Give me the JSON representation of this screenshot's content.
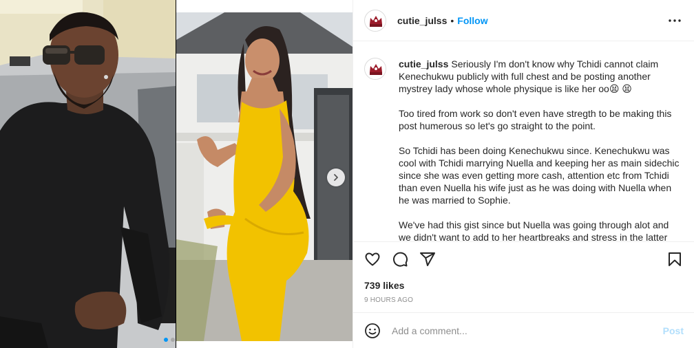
{
  "post": {
    "username": "cutie_julss",
    "separator": "•",
    "follow_label": "Follow",
    "more_icon": "more-horizontal-icon"
  },
  "caption": {
    "username": "cutie_julss",
    "paragraphs": [
      "Seriously I'm don't know why Tchidi cannot claim Kenechukwu publicly with full chest and be posting another mystrey lady whose whole physique is like her oo😫 😫",
      "Too tired from work so don't even have stregth to be making this post humerous so let's go straight to the point.",
      "So Tchidi has been doing Kenechukwu since. Kenechukwu was cool with Tchidi marrying Nuella and keeping her as main sidechic since she was even getting more cash, attention etc from Tchidi than even Nuella his wife just as he was doing with Nuella when he was married to Sophie.",
      "We've had this gist since but Nuella was going through alot and we didn't want to add to her heartbreaks and stress in the latter part of"
    ]
  },
  "engagement": {
    "likes": "739 likes",
    "time": "9 HOURS AGO"
  },
  "comment": {
    "placeholder": "Add a comment...",
    "post_label": "Post"
  },
  "carousel": {
    "slides": 2,
    "active_slide": 1
  },
  "colors": {
    "accent": "#0095f6",
    "muted": "#8e8e8e",
    "post_disabled": "#b2dffc",
    "dress_yellow": "#f2c200"
  }
}
